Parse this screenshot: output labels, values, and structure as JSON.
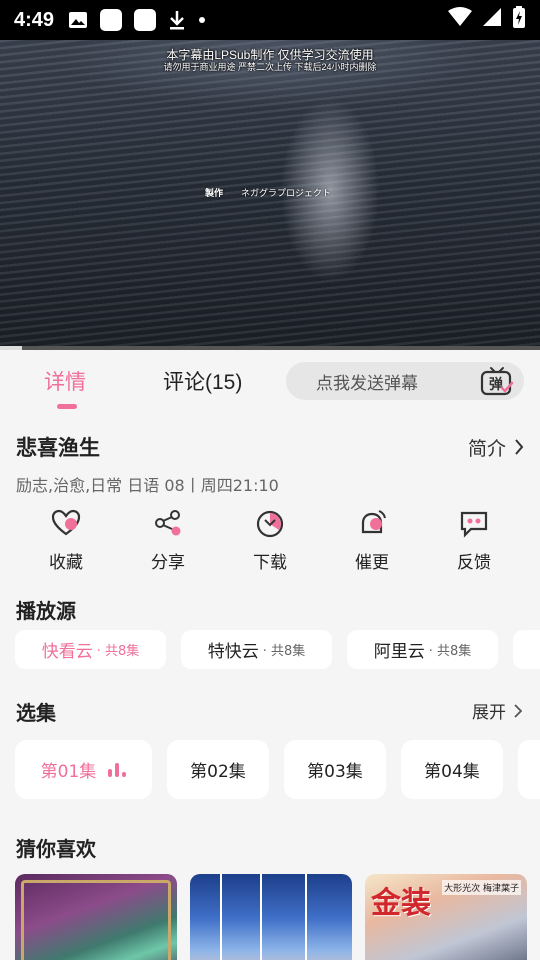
{
  "status_bar": {
    "time": "4:49"
  },
  "video": {
    "subtitle_line1": "本字幕由LPSub制作 仅供学习交流使用",
    "subtitle_line2": "请勿用于商业用途 严禁二次上传 下载后24小时内删除",
    "credit_label": "製作",
    "credit_value": "ネガグラプロジェクト",
    "progress_fraction": 0.04
  },
  "tabs": {
    "details": "详情",
    "comments": "评论(15)"
  },
  "danmaku": {
    "placeholder": "点我发送弹幕",
    "icon_text": "弹"
  },
  "anime": {
    "title": "悲喜渔生",
    "intro_label": "简介",
    "meta": "励志,治愈,日常 日语 08丨周四21:10"
  },
  "actions": [
    {
      "label": "收藏",
      "icon": "heart-icon"
    },
    {
      "label": "分享",
      "icon": "share-icon"
    },
    {
      "label": "下载",
      "icon": "download-icon"
    },
    {
      "label": "催更",
      "icon": "bell-icon"
    },
    {
      "label": "反馈",
      "icon": "feedback-icon"
    }
  ],
  "sources": {
    "title": "播放源",
    "items": [
      {
        "name": "快看云",
        "count": "· 共8集"
      },
      {
        "name": "特快云",
        "count": "· 共8集"
      },
      {
        "name": "阿里云",
        "count": "· 共8集"
      }
    ]
  },
  "episodes": {
    "title": "选集",
    "expand_label": "展开",
    "items": [
      "第01集",
      "第02集",
      "第03集",
      "第04集"
    ]
  },
  "recommend": {
    "title": "猜你喜欢",
    "poster3_big_text": "金装",
    "poster3_small_text": "大形光次 梅津葉子"
  },
  "colors": {
    "accent": "#f0709a",
    "background": "#f5f5f5"
  }
}
